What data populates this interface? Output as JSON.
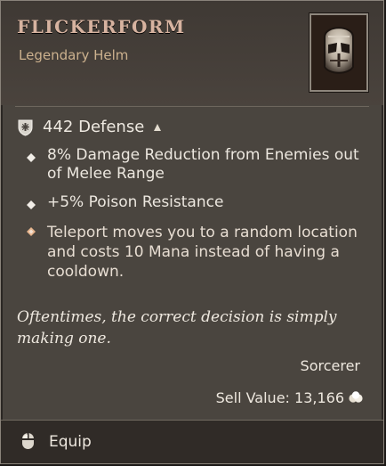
{
  "item": {
    "name": "FLICKERFORM",
    "type": "Legendary Helm",
    "icon": "helm-icon"
  },
  "stats": {
    "defense": "442 Defense",
    "defense_icon": "shield-icon",
    "upgrade_icon": "upgrade-arrow-icon",
    "affixes": [
      "8% Damage Reduction from Enemies out of Melee Range",
      "+5% Poison Resistance"
    ],
    "aspect": "Teleport moves you to a random location and costs 10 Mana instead of having a cooldown."
  },
  "flavor_text": "Oftentimes, the correct decision is simply making one.",
  "class_requirement": "Sorcerer",
  "sell_value": "Sell Value: 13,166",
  "sell_icon": "gold-icon",
  "actions": {
    "equip_label": "Equip",
    "equip_icon": "mouse-icon"
  },
  "colors": {
    "name": "#d7b3a0",
    "item_type": "#ccb18e",
    "panel": "#4a453f"
  }
}
